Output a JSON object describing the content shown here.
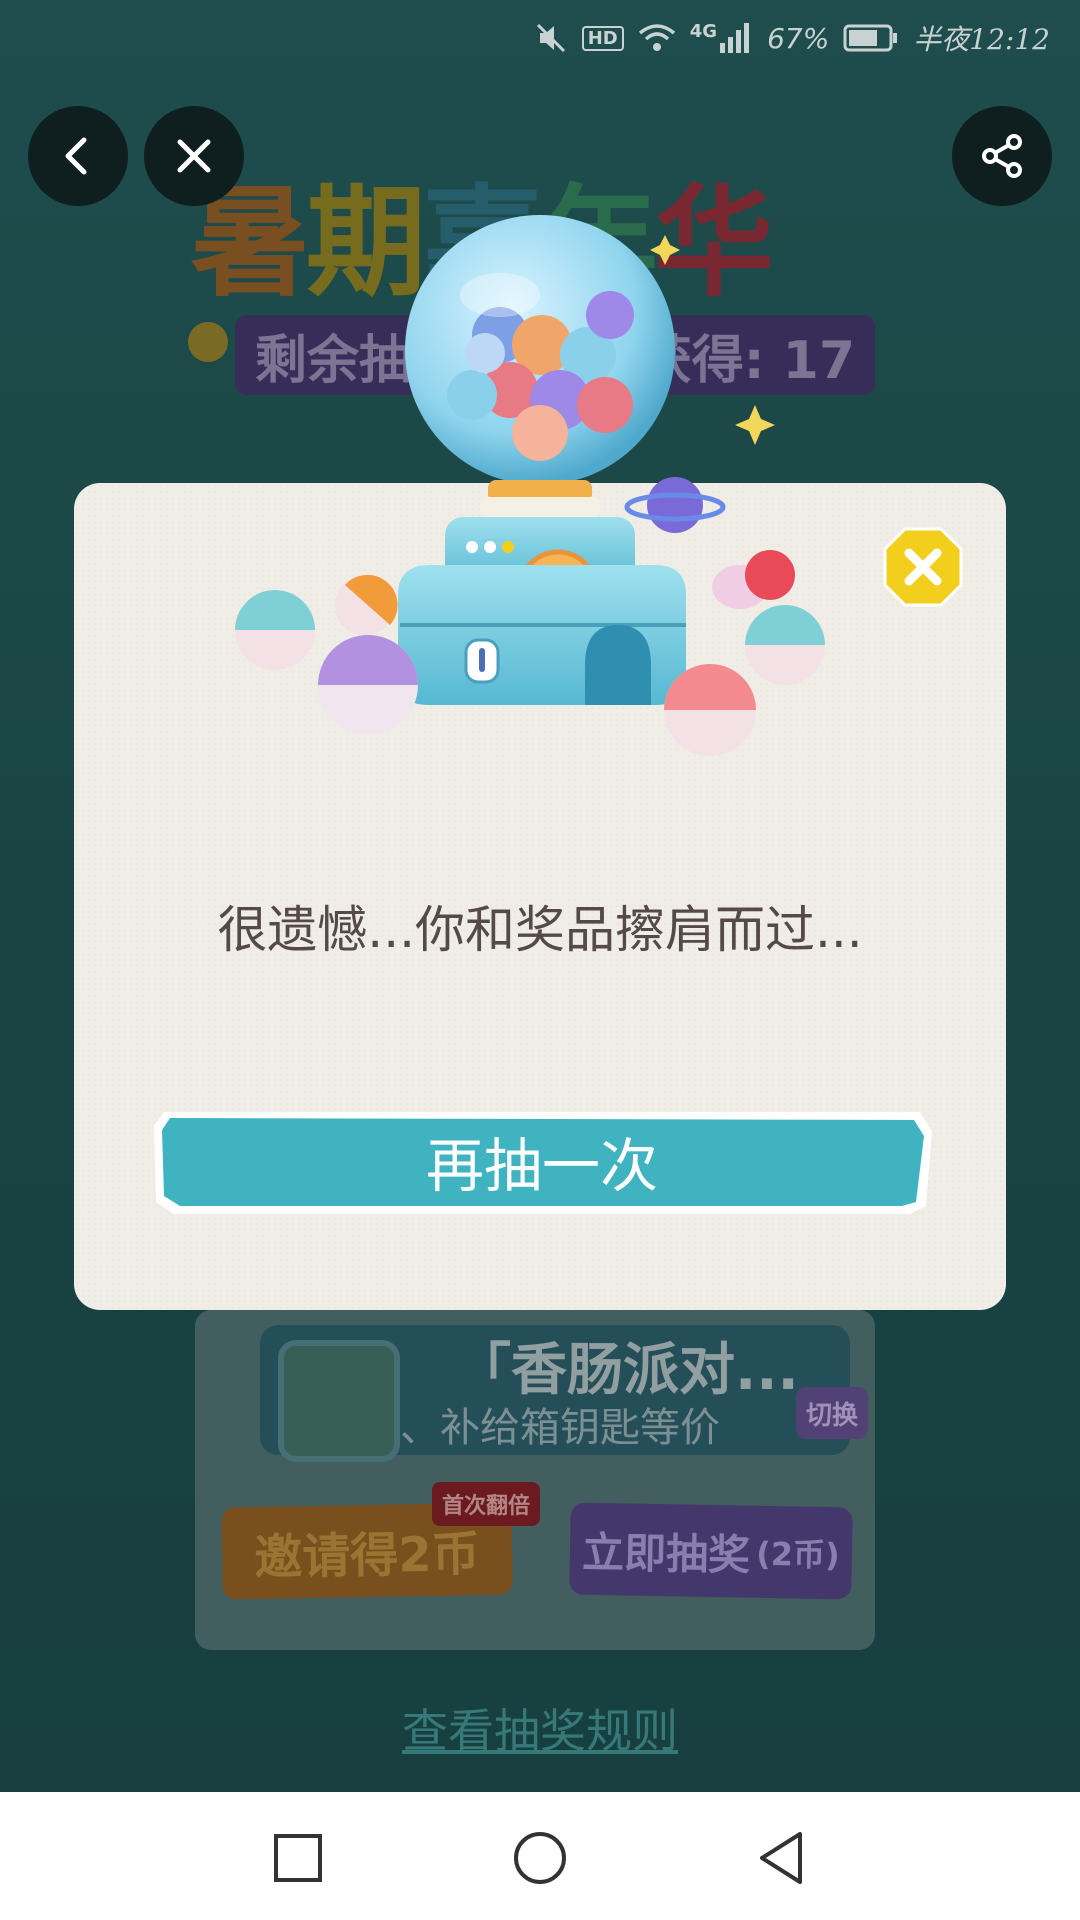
{
  "status_bar": {
    "signal_label": "4G",
    "hd_label": "HD",
    "battery": "67%",
    "time": "半夜12:12"
  },
  "background": {
    "title_chars": [
      "暑",
      "期",
      "嘉",
      "年",
      "华"
    ],
    "sub_left": "剩余抽",
    "sub_right": "获得: 17",
    "game_title": "「香肠派对...",
    "game_desc": "、补给箱钥匙等价",
    "switch_label": "切换",
    "invite_label": "邀请得2币",
    "first_double_badge": "首次翻倍",
    "draw_label": "立即抽奖",
    "draw_cost": "(2币)",
    "rules_link": "查看抽奖规则"
  },
  "modal": {
    "message": "很遗憾...你和奖品擦肩而过...",
    "retry_label": "再抽一次"
  },
  "colors": {
    "accent_teal": "#40b3c0",
    "close_yellow": "#f3cf1d",
    "modal_bg": "#efede5"
  },
  "icons": {
    "back": "back-arrow-icon",
    "close": "close-icon",
    "share": "share-icon",
    "modal_close": "close-icon",
    "nav_recent": "square-icon",
    "nav_home": "circle-icon",
    "nav_back": "triangle-back-icon"
  }
}
